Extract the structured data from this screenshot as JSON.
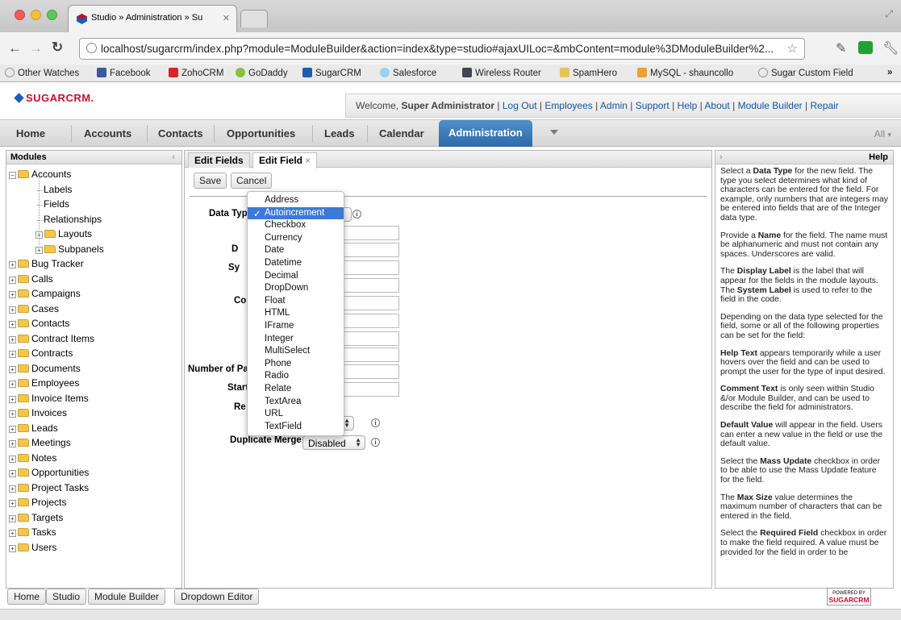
{
  "browser": {
    "tab_title": "Studio » Administration » Su",
    "tab_close": "✕",
    "url": "localhost/sugarcrm/index.php?module=ModuleBuilder&action=index&type=studio#ajaxUILoc=&mbContent=module%3DModuleBuilder%2...",
    "bookmarks": [
      "Other Watches",
      "Facebook",
      "ZohoCRM",
      "GoDaddy",
      "SugarCRM",
      "Salesforce",
      "Wireless Router",
      "SpamHero",
      "MySQL - shauncollo",
      "Sugar Custom Field"
    ],
    "bookmarks_more": "»"
  },
  "header": {
    "logo": "SUGARCRM.",
    "welcome_prefix": "Welcome,",
    "user": "Super Administrator",
    "links": [
      "Log Out",
      "Employees",
      "Admin",
      "Support",
      "Help",
      "About",
      "Module Builder",
      "Repair"
    ],
    "separator": "|"
  },
  "nav": {
    "tabs": [
      "Home",
      "Accounts",
      "Contacts",
      "Opportunities",
      "Leads",
      "Calendar",
      "Administration"
    ],
    "active": "Administration",
    "all": "All"
  },
  "modules_panel": {
    "title": "Modules",
    "collapse": "‹",
    "tree": [
      {
        "label": "Accounts",
        "toggle": "−"
      },
      {
        "label": "Labels"
      },
      {
        "label": "Fields"
      },
      {
        "label": "Relationships"
      },
      {
        "label": "Layouts",
        "toggle": "+"
      },
      {
        "label": "Subpanels",
        "toggle": "+"
      },
      {
        "label": "Bug Tracker",
        "toggle": "+"
      },
      {
        "label": "Calls",
        "toggle": "+"
      },
      {
        "label": "Campaigns",
        "toggle": "+"
      },
      {
        "label": "Cases",
        "toggle": "+"
      },
      {
        "label": "Contacts",
        "toggle": "+"
      },
      {
        "label": "Contract Items",
        "toggle": "+"
      },
      {
        "label": "Contracts",
        "toggle": "+"
      },
      {
        "label": "Documents",
        "toggle": "+"
      },
      {
        "label": "Employees",
        "toggle": "+"
      },
      {
        "label": "Invoice Items",
        "toggle": "+"
      },
      {
        "label": "Invoices",
        "toggle": "+"
      },
      {
        "label": "Leads",
        "toggle": "+"
      },
      {
        "label": "Meetings",
        "toggle": "+"
      },
      {
        "label": "Notes",
        "toggle": "+"
      },
      {
        "label": "Opportunities",
        "toggle": "+"
      },
      {
        "label": "Project Tasks",
        "toggle": "+"
      },
      {
        "label": "Projects",
        "toggle": "+"
      },
      {
        "label": "Targets",
        "toggle": "+"
      },
      {
        "label": "Tasks",
        "toggle": "+"
      },
      {
        "label": "Users",
        "toggle": "+"
      }
    ]
  },
  "editor": {
    "tabs": [
      "Edit Fields",
      "Edit Field"
    ],
    "tab_close": "×",
    "save": "Save",
    "cancel": "Cancel",
    "labels": {
      "data_type": "Data Typ",
      "display_label": "D",
      "system_label": "Sy",
      "comment": "Co",
      "number_of_pages": "Number of Pa",
      "start": "Start",
      "required": "Re",
      "duplicate_merge": "Duplicate Merge:"
    },
    "duplicate_merge_value": "Disabled",
    "info": "i",
    "data_type_options": [
      "Address",
      "Autoincrement",
      "Checkbox",
      "Currency",
      "Date",
      "Datetime",
      "Decimal",
      "DropDown",
      "Float",
      "HTML",
      "IFrame",
      "Integer",
      "MultiSelect",
      "Phone",
      "Radio",
      "Relate",
      "TextArea",
      "URL",
      "TextField"
    ],
    "selected_option": "Autoincrement",
    "check": "✓"
  },
  "help": {
    "collapse": "›",
    "title": "Help",
    "paragraphs": [
      [
        {
          "t": "Select a "
        },
        {
          "b": "Data Type"
        },
        {
          "t": " for the new field. The type you select determines what kind of characters can be entered for the field. For example, only numbers that are integers may be entered into fields that are of the Integer data type."
        }
      ],
      [
        {
          "t": "Provide a "
        },
        {
          "b": "Name"
        },
        {
          "t": " for the field. The name must be alphanumeric and must not contain any spaces. Underscores are valid."
        }
      ],
      [
        {
          "t": "The "
        },
        {
          "b": "Display Label"
        },
        {
          "t": " is the label that will appear for the fields in the module layouts. The "
        },
        {
          "b": "System Label"
        },
        {
          "t": " is used to refer to the field in the code."
        }
      ],
      [
        {
          "t": "Depending on the data type selected for the field, some or all of the following properties can be set for the field:"
        }
      ],
      [
        {
          "b": "Help Text"
        },
        {
          "t": " appears temporarily while a user hovers over the field and can be used to prompt the user for the type of input desired."
        }
      ],
      [
        {
          "b": "Comment Text"
        },
        {
          "t": " is only seen within Studio &/or Module Builder, and can be used to describe the field for administrators."
        }
      ],
      [
        {
          "b": "Default Value"
        },
        {
          "t": " will appear in the field. Users can enter a new value in the field or use the default value."
        }
      ],
      [
        {
          "t": "Select the "
        },
        {
          "b": "Mass Update"
        },
        {
          "t": " checkbox in order to be able to use the Mass Update feature for the field."
        }
      ],
      [
        {
          "t": "The "
        },
        {
          "b": "Max Size"
        },
        {
          "t": " value determines the maximum number of characters that can be entered in the field."
        }
      ],
      [
        {
          "t": "Select the "
        },
        {
          "b": "Required Field"
        },
        {
          "t": " checkbox in order to make the field required. A value must be provided for the field in order to be"
        }
      ]
    ]
  },
  "footer": {
    "buttons": [
      "Home",
      "Studio",
      "Module Builder",
      "Dropdown Editor"
    ],
    "powered_line1": "POWERED BY",
    "powered_line2": "SUGARCRM"
  },
  "colors": {
    "accent": "#2e6aa7",
    "brand": "#c8102e",
    "link": "#13569d",
    "selection": "#3b7bd8"
  }
}
